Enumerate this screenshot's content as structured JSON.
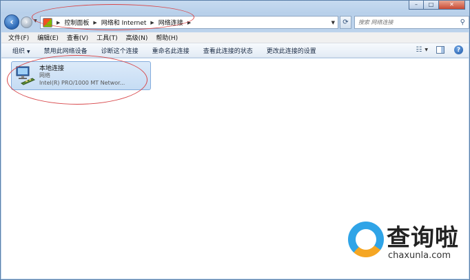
{
  "window": {
    "caption_buttons": {
      "minimize": "–",
      "maximize": "□",
      "close": "✕"
    }
  },
  "nav": {
    "back_icon": "back-arrow-icon",
    "forward_icon": "forward-arrow-icon"
  },
  "address": {
    "crumbs": [
      "控制面板",
      "网络和 Internet",
      "网络连接"
    ],
    "search_placeholder": "搜索 网络连接"
  },
  "menu": {
    "items": [
      "文件(F)",
      "编辑(E)",
      "查看(V)",
      "工具(T)",
      "高级(N)",
      "帮助(H)"
    ]
  },
  "toolbar": {
    "organize": "组织",
    "commands": [
      "禁用此网络设备",
      "诊断这个连接",
      "重命名此连接",
      "查看此连接的状态",
      "更改此连接的设置"
    ]
  },
  "connection": {
    "name": "本地连接",
    "status": "网络",
    "device": "Intel(R) PRO/1000 MT Networ..."
  },
  "watermark": {
    "title": "查询啦",
    "url": "chaxunla.com"
  },
  "colors": {
    "annotation": "#d8474a",
    "accent": "#2a66b3",
    "selection": "#c5dcf4"
  }
}
